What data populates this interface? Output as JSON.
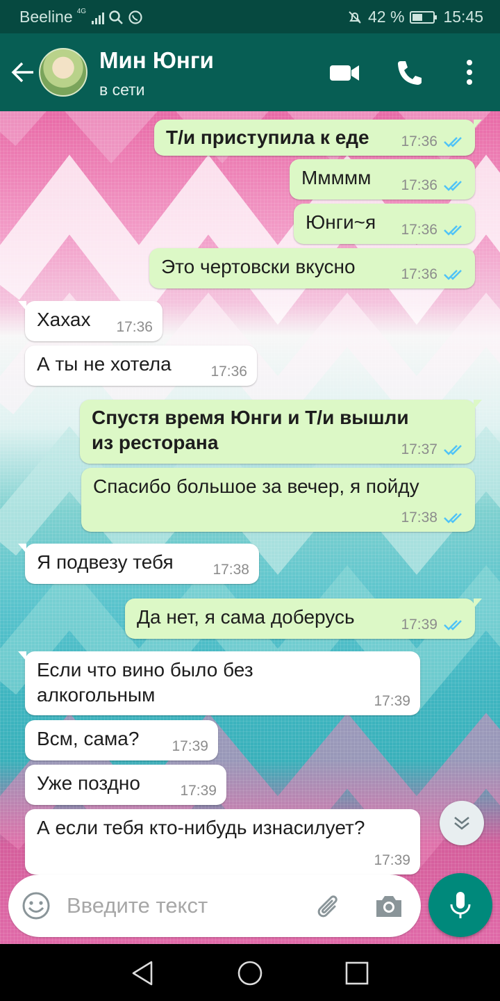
{
  "status_bar": {
    "carrier": "Beeline",
    "network": "4G",
    "battery": "42 %",
    "time": "15:45",
    "icons": [
      "signal-icon",
      "search-icon",
      "whatsapp-icon",
      "mute-bell-icon",
      "battery-icon"
    ]
  },
  "header": {
    "contact_name": "Мин Юнги",
    "status": "в сети",
    "icons": [
      "back-arrow-icon",
      "video-call-icon",
      "phone-call-icon",
      "more-vert-icon"
    ]
  },
  "messages": [
    {
      "dir": "out",
      "text": "Т/и приступила к еде",
      "time": "17:36",
      "bold": true
    },
    {
      "dir": "out",
      "text": "Ммммм",
      "time": "17:36"
    },
    {
      "dir": "out",
      "text": "Юнги~я",
      "time": "17:36"
    },
    {
      "dir": "out",
      "text": "Это чертовски вкусно",
      "time": "17:36"
    },
    {
      "dir": "in",
      "text": "Хахах",
      "time": "17:36"
    },
    {
      "dir": "in",
      "text": "А ты не хотела",
      "time": "17:36"
    },
    {
      "dir": "out",
      "lines": [
        "Спустя время Юнги и Т/и вышли",
        "из ресторана"
      ],
      "time": "17:37",
      "bold": true
    },
    {
      "dir": "out",
      "text": "Спасибо большое за вечер, я пойду",
      "time": "17:38"
    },
    {
      "dir": "in",
      "text": "Я подвезу тебя",
      "time": "17:38"
    },
    {
      "dir": "out",
      "text": "Да нет, я сама доберусь",
      "time": "17:39"
    },
    {
      "dir": "in",
      "lines": [
        "Если что вино было без",
        "алкогольным"
      ],
      "time": "17:39"
    },
    {
      "dir": "in",
      "text": "Всм, сама?",
      "time": "17:39"
    },
    {
      "dir": "in",
      "text": "Уже поздно",
      "time": "17:39"
    },
    {
      "dir": "in",
      "text": "А если тебя кто-нибудь изнасилует?",
      "time": "17:39"
    }
  ],
  "composer": {
    "placeholder": "Введите текст",
    "icons": [
      "emoji-icon",
      "attach-icon",
      "camera-icon",
      "mic-icon"
    ]
  },
  "colors": {
    "header": "#075e54",
    "status_bar": "#064940",
    "outgoing_bubble": "#dcf8c6",
    "incoming_bubble": "#ffffff",
    "read_ticks": "#4fc3f7",
    "fab": "#00897b"
  }
}
